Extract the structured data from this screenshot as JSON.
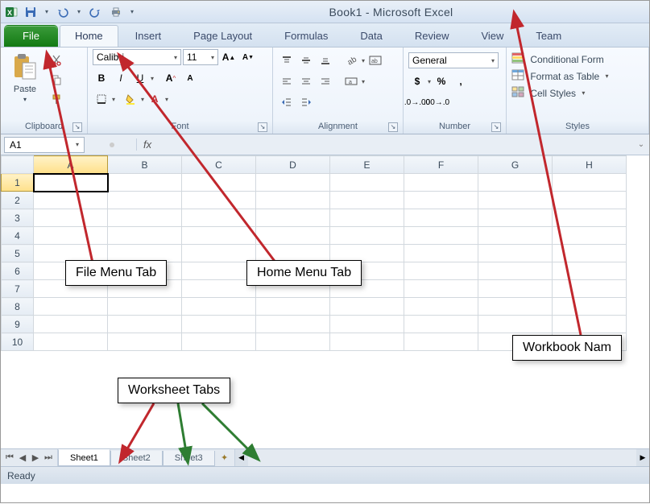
{
  "titlebar": {
    "title": "Book1  -  Microsoft Excel"
  },
  "ribbon_tabs": {
    "file": "File",
    "home": "Home",
    "insert": "Insert",
    "page_layout": "Page Layout",
    "formulas": "Formulas",
    "data": "Data",
    "review": "Review",
    "view": "View",
    "team": "Team"
  },
  "ribbon": {
    "clipboard": {
      "label": "Clipboard",
      "paste": "Paste"
    },
    "font": {
      "label": "Font",
      "name": "Calibri",
      "size": "11",
      "bold": "B",
      "italic": "I",
      "underline": "U"
    },
    "alignment": {
      "label": "Alignment"
    },
    "number": {
      "label": "Number",
      "format": "General"
    },
    "styles": {
      "label": "Styles",
      "cond": "Conditional Form",
      "table": "Format as Table",
      "cell": "Cell Styles"
    }
  },
  "formula_bar": {
    "name_box": "A1",
    "fx": "fx",
    "value": ""
  },
  "grid": {
    "columns": [
      "A",
      "B",
      "C",
      "D",
      "E",
      "F",
      "G",
      "H"
    ],
    "rows": [
      "1",
      "2",
      "3",
      "4",
      "5",
      "6",
      "7",
      "8",
      "9",
      "10"
    ],
    "active_col": "A",
    "active_row": "1"
  },
  "sheet_tabs": {
    "sheets": [
      "Sheet1",
      "Sheet2",
      "Sheet3"
    ],
    "active": "Sheet1"
  },
  "status": {
    "text": "Ready"
  },
  "annotations": {
    "file_tab": "File Menu Tab",
    "home_tab": "Home Menu Tab",
    "worksheet_tabs": "Worksheet Tabs",
    "workbook_name": "Workbook Nam"
  },
  "colors": {
    "file_tab_bg": "#1f8a1f",
    "arrow_red": "#c1272d",
    "arrow_green": "#2e7d32"
  }
}
